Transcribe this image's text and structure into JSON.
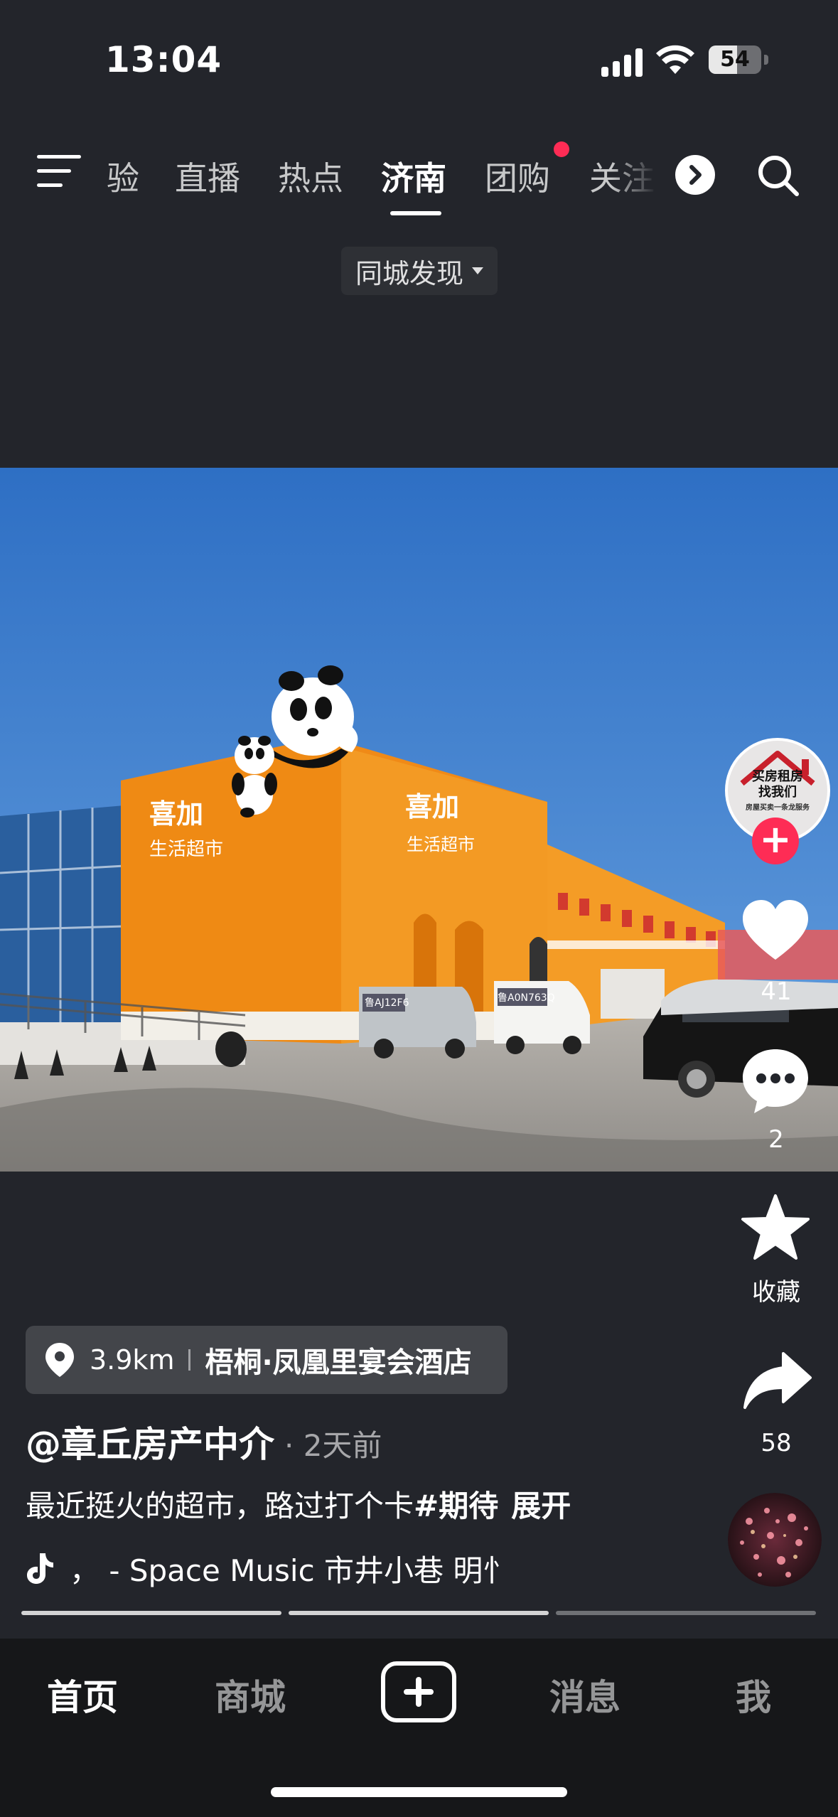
{
  "status_bar": {
    "time": "13:04",
    "battery": "54",
    "battery_level": 0.54
  },
  "top_nav": {
    "tabs": [
      {
        "label": "验"
      },
      {
        "label": "直播"
      },
      {
        "label": "热点"
      },
      {
        "label": "济南",
        "active": true
      },
      {
        "label": "团购",
        "badge_dot": true
      },
      {
        "label": "关注"
      }
    ],
    "city_filter": "同城发现"
  },
  "video": {
    "storefront_sign": "喜加",
    "storefront_sub": "生活超市",
    "plates": [
      "鲁AJ12F6",
      "鲁A0N763Q"
    ]
  },
  "actions": {
    "avatar_text_line1": "买房租房",
    "avatar_text_line2": "找我们",
    "avatar_text_line3": "房屋买卖一条龙服务",
    "likes": "41",
    "comments": "2",
    "favorite_label": "收藏",
    "shares": "58"
  },
  "post": {
    "distance": "3.9km",
    "place": "梧桐·凤凰里宴会酒店",
    "author": "@章丘房产中介",
    "time": "· 2天前",
    "caption": "最近挺火的超市，路过打个卡",
    "hashtag": "#期待",
    "expand": "展开",
    "music": "， - Space Music    市井小巷  明忄"
  },
  "tab_bar": {
    "home": "首页",
    "mall": "商城",
    "messages": "消息",
    "me": "我"
  },
  "colors": {
    "accent": "#fe2c55",
    "background": "#23252b",
    "tabbar": "#161719"
  }
}
